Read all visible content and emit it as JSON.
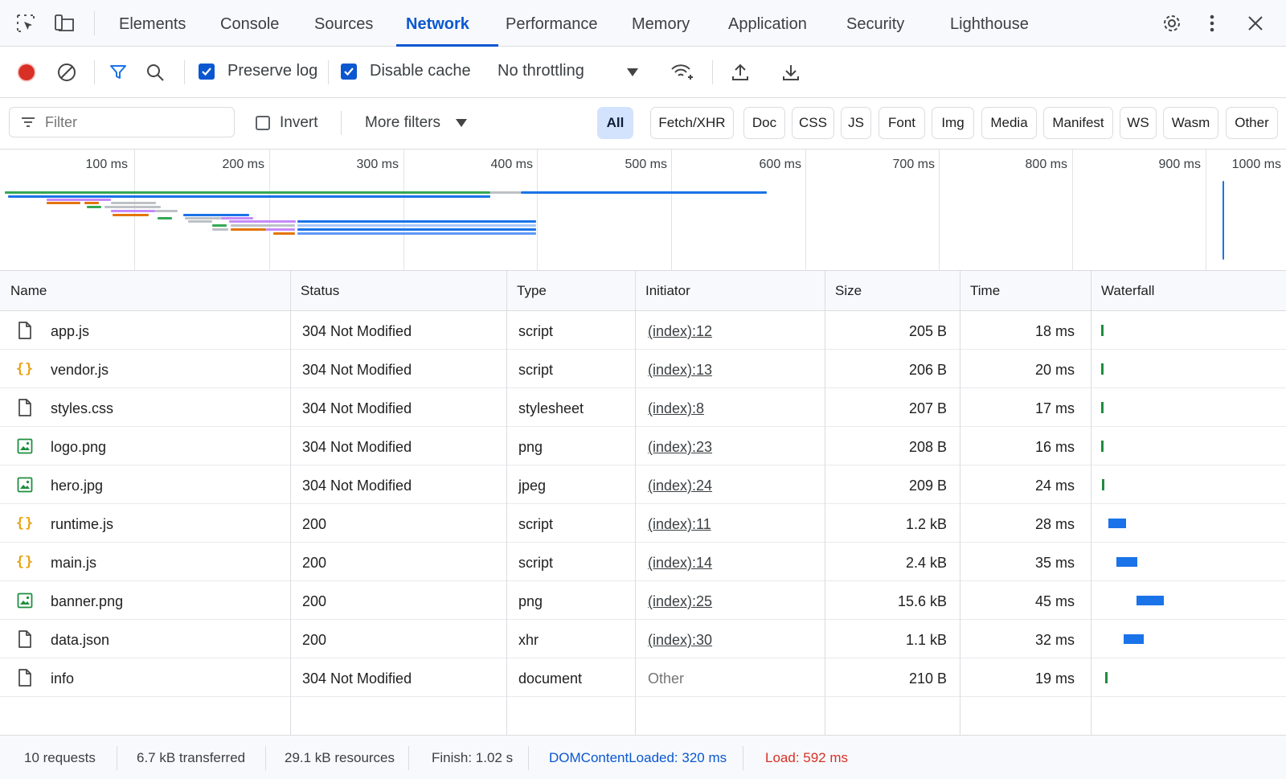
{
  "tabs": [
    "Elements",
    "Console",
    "Sources",
    "Network",
    "Performance",
    "Memory",
    "Application",
    "Security",
    "Lighthouse"
  ],
  "active_tab": "Network",
  "toolbar": {
    "preserve_log_label": "Preserve log",
    "preserve_log_checked": true,
    "disable_cache_label": "Disable cache",
    "disable_cache_checked": true,
    "throttling_value": "No throttling",
    "recording": true
  },
  "filter": {
    "placeholder": "Filter",
    "invert_label": "Invert",
    "invert_checked": false,
    "more_filters_label": "More filters",
    "chips": [
      "All",
      "Fetch/XHR",
      "Doc",
      "CSS",
      "JS",
      "Font",
      "Img",
      "Media",
      "Manifest",
      "WS",
      "Wasm",
      "Other"
    ],
    "active_chip": "All"
  },
  "overview": {
    "ticks": [
      "100 ms",
      "200 ms",
      "300 ms",
      "400 ms",
      "500 ms",
      "600 ms",
      "700 ms",
      "800 ms",
      "900 ms",
      "1000 ms"
    ]
  },
  "table": {
    "columns": [
      "Name",
      "Status",
      "Type",
      "Initiator",
      "Size",
      "Time",
      "Waterfall"
    ],
    "rows": [
      {
        "name": "app.js",
        "icon": "document-icon",
        "status": "304  Not Modified",
        "type": "script",
        "initiator": "(index):12",
        "size": "205 B",
        "time": "18 ms",
        "wf_start_ms": 0,
        "wf_duration_ms": 18,
        "wf_color": "#1e8e3e"
      },
      {
        "name": "vendor.js",
        "icon": "script-braces-icon",
        "status": "304  Not Modified",
        "type": "script",
        "initiator": "(index):13",
        "size": "206 B",
        "time": "20 ms",
        "wf_start_ms": 0,
        "wf_duration_ms": 20,
        "wf_color": "#1e8e3e"
      },
      {
        "name": "styles.css",
        "icon": "document-icon",
        "status": "304  Not Modified",
        "type": "stylesheet",
        "initiator": "(index):8",
        "size": "207 B",
        "time": "17 ms",
        "wf_start_ms": 0,
        "wf_duration_ms": 17,
        "wf_color": "#1e8e3e"
      },
      {
        "name": "logo.png",
        "icon": "image-icon",
        "status": "304  Not Modified",
        "type": "png",
        "initiator": "(index):23",
        "size": "208 B",
        "time": "16 ms",
        "wf_start_ms": 0,
        "wf_duration_ms": 16,
        "wf_color": "#1e8e3e"
      },
      {
        "name": "hero.jpg",
        "icon": "image-icon",
        "status": "304  Not Modified",
        "type": "jpeg",
        "initiator": "(index):24",
        "size": "209 B",
        "time": "24 ms",
        "wf_start_ms": 1,
        "wf_duration_ms": 24,
        "wf_color": "#1e8e3e"
      },
      {
        "name": "runtime.js",
        "icon": "script-braces-icon",
        "status": "200",
        "type": "script",
        "initiator": "(index):11",
        "size": "1.2 kB",
        "time": "28 ms",
        "wf_start_ms": 9,
        "wf_duration_ms": 28,
        "wf_color": "#1a73e8"
      },
      {
        "name": "main.js",
        "icon": "script-braces-icon",
        "status": "200",
        "type": "script",
        "initiator": "(index):14",
        "size": "2.4 kB",
        "time": "35 ms",
        "wf_start_ms": 18,
        "wf_duration_ms": 35,
        "wf_color": "#1a73e8"
      },
      {
        "name": "banner.png",
        "icon": "image-icon",
        "status": "200",
        "type": "png",
        "initiator": "(index):25",
        "size": "15.6 kB",
        "time": "45 ms",
        "wf_start_ms": 42,
        "wf_duration_ms": 45,
        "wf_color": "#1a73e8"
      },
      {
        "name": "data.json",
        "icon": "document-icon",
        "status": "200",
        "type": "xhr",
        "initiator": "(index):30",
        "size": "1.1 kB",
        "time": "32 ms",
        "wf_start_ms": 27,
        "wf_duration_ms": 32,
        "wf_color": "#1a73e8"
      },
      {
        "name": "info",
        "icon": "document-icon",
        "status": "304  Not Modified",
        "type": "document",
        "initiator": "Other",
        "size": "210 B",
        "time": "19 ms",
        "wf_start_ms": 5,
        "wf_duration_ms": 19,
        "wf_color": "#1e8e3e"
      }
    ]
  },
  "status_bar": {
    "requests": "10 requests",
    "transferred": "6.7 kB transferred",
    "resources": "29.1 kB resources",
    "finish": "Finish: 1.02 s",
    "dom_content_loaded": "DOMContentLoaded: 320 ms",
    "load": "Load: 592 ms",
    "dom_color": "#0b57d0",
    "load_color": "#d93025"
  },
  "colors": {
    "accent": "#0b57d0",
    "record": "#d93025",
    "script_icon": "#e8a317",
    "image_icon": "#1e8e3e"
  }
}
